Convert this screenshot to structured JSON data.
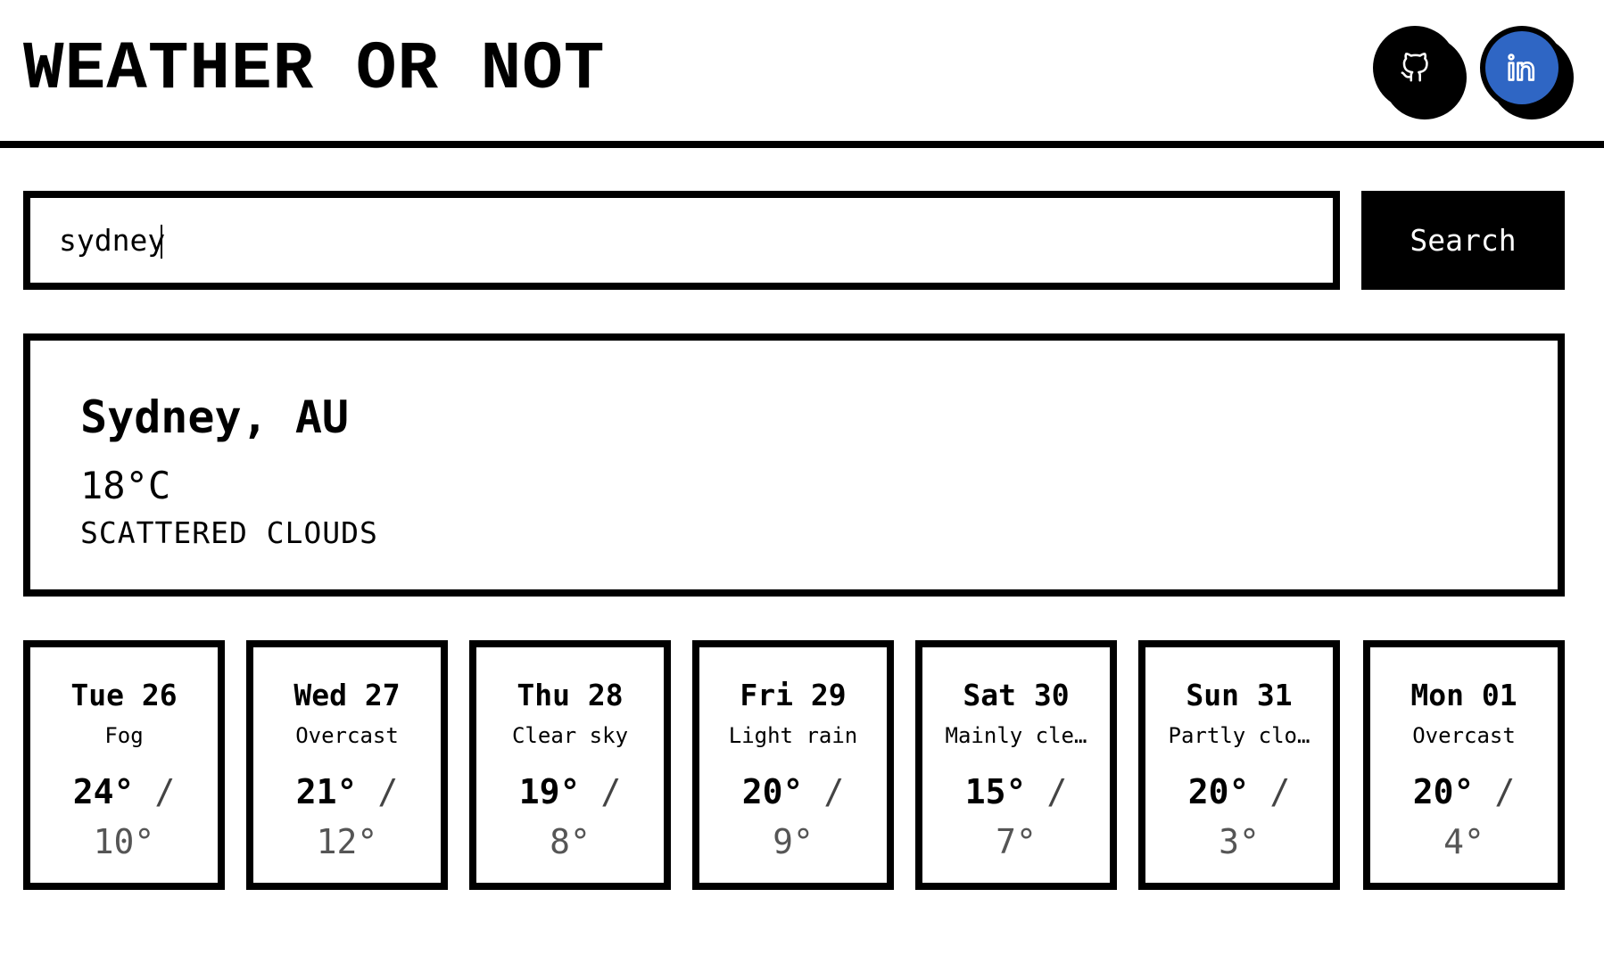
{
  "app": {
    "title": "WEATHER OR NOT"
  },
  "social": {
    "github": {
      "icon": "github-icon",
      "color": "#000000"
    },
    "linkedin": {
      "icon": "linkedin-icon",
      "color": "#2f66c4"
    }
  },
  "search": {
    "value": "sydney",
    "button_label": "Search"
  },
  "current": {
    "city": "Sydney, AU",
    "temperature": "18°C",
    "description": "SCATTERED CLOUDS"
  },
  "forecast": [
    {
      "date": "Tue 26",
      "condition": "Fog",
      "high": "24°",
      "low": "10°"
    },
    {
      "date": "Wed 27",
      "condition": "Overcast",
      "high": "21°",
      "low": "12°"
    },
    {
      "date": "Thu 28",
      "condition": "Clear sky",
      "high": "19°",
      "low": "8°"
    },
    {
      "date": "Fri 29",
      "condition": "Light rain",
      "high": "20°",
      "low": "9°"
    },
    {
      "date": "Sat 30",
      "condition": "Mainly cle…",
      "high": "15°",
      "low": "7°"
    },
    {
      "date": "Sun 31",
      "condition": "Partly clo…",
      "high": "20°",
      "low": "3°"
    },
    {
      "date": "Mon 01",
      "condition": "Overcast",
      "high": "20°",
      "low": "4°"
    }
  ],
  "colors": {
    "accent": "#2f66c4",
    "border": "#000000",
    "muted": "#555555"
  }
}
